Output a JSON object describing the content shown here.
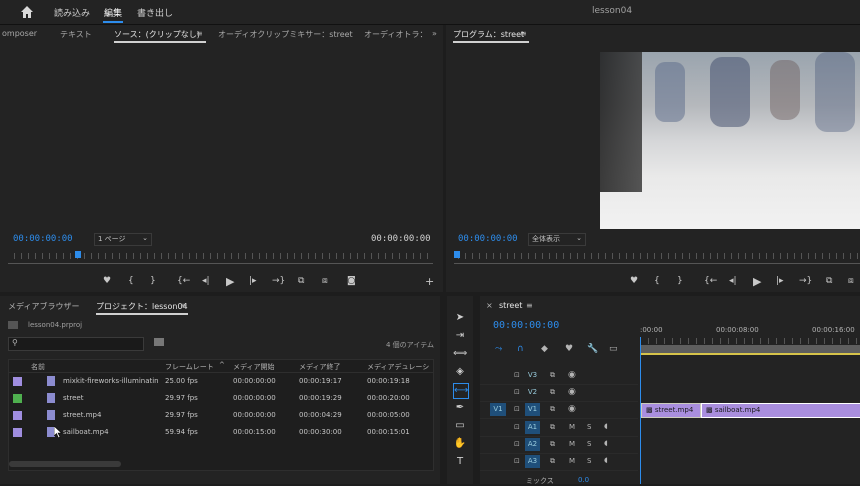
{
  "menu": {
    "home_icon": "home-icon",
    "import": "読み込み",
    "edit": "編集",
    "export": "書き出し",
    "project_title": "lesson04"
  },
  "source_panel": {
    "tabs": [
      "omposer",
      "テキスト",
      "ソース：(クリップなし)",
      "オーディオクリップミキサー：street",
      "オーディオトラ："
    ],
    "timecode_in": "00:00:00:00",
    "zoom": "1 ページ",
    "timecode_out": "00:00:00:00"
  },
  "program_panel": {
    "tab": "プログラム：street",
    "timecode": "00:00:00:00",
    "fit": "全体表示"
  },
  "project_panel": {
    "tabs": [
      "メディアブラウザー",
      "プロジェクト：lesson04"
    ],
    "file": "lesson04.prproj",
    "search_placeholder": "",
    "item_count": "4 個のアイテム",
    "columns": [
      "名前",
      "フレームレート",
      "メディア開始",
      "メディア終了",
      "メディアデュレーシ"
    ],
    "rows": [
      {
        "color": "#a08ee0",
        "name": "mixkit-fireworks-illuminatin",
        "fps": "25.00 fps",
        "start": "00:00:00:00",
        "end": "00:00:19:17",
        "dur": "00:00:19:18"
      },
      {
        "color": "#4fb04f",
        "name": "street",
        "fps": "29.97 fps",
        "start": "00:00:00:00",
        "end": "00:00:19:29",
        "dur": "00:00:20:00"
      },
      {
        "color": "#a08ee0",
        "name": "street.mp4",
        "fps": "29.97 fps",
        "start": "00:00:00:00",
        "end": "00:00:04:29",
        "dur": "00:00:05:00"
      },
      {
        "color": "#a08ee0",
        "name": "sailboat.mp4",
        "fps": "59.94 fps",
        "start": "00:00:15:00",
        "end": "00:00:30:00",
        "dur": "00:00:15:01"
      }
    ]
  },
  "timeline": {
    "tab": "street",
    "timecode": "00:00:00:00",
    "ruler": [
      ":00:00",
      "00:00:08:00",
      "00:00:16:00"
    ],
    "tracks": [
      "V3",
      "V2",
      "V1",
      "A1",
      "A2",
      "A3"
    ],
    "v1_source": "V1",
    "clips": [
      {
        "label": "street.mp4"
      },
      {
        "label": "sailboat.mp4"
      }
    ],
    "mix_label": "ミックス",
    "mix_value": "0.0",
    "track_buttons": {
      "lock": "lock-icon",
      "mute": "M",
      "solo": "S"
    }
  },
  "colors": {
    "accent": "#2d8ceb",
    "clip": "#a98ede",
    "panel": "#232323"
  }
}
